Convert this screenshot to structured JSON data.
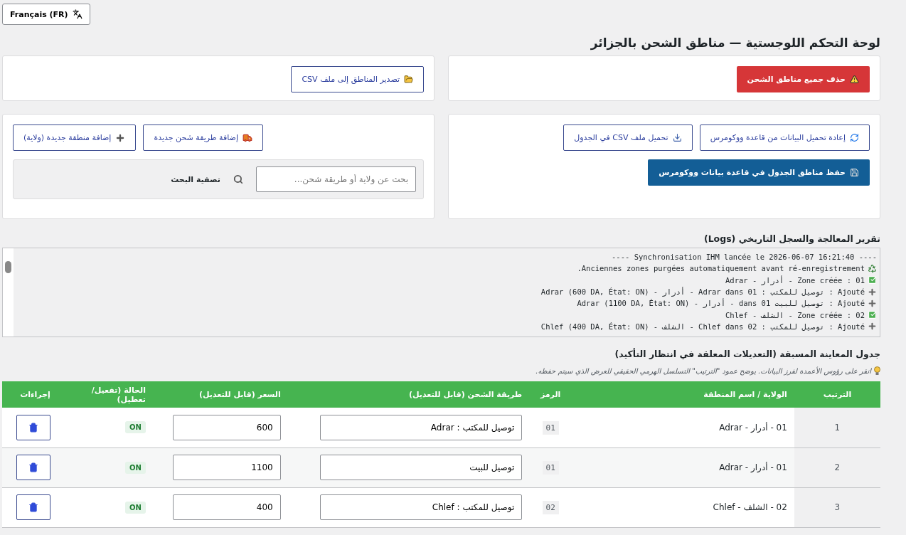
{
  "language_button": {
    "label": "Français (FR)"
  },
  "title": "لوحة التحكم اللوجستية — مناطق الشحن بالجزائر",
  "delete_all_button": {
    "label": "حذف جميع مناطق الشحن"
  },
  "export_button": {
    "label": "تصدير المناطق إلى ملف CSV"
  },
  "reload_button": {
    "label": "إعادة تحميل البيانات من قاعدة ووكومرس"
  },
  "upload_button": {
    "label": "تحميل ملف CSV في الجدول"
  },
  "save_button": {
    "label": "حفظ مناطق الجدول في قاعدة بيانات ووكومرس"
  },
  "add_method_button": {
    "label": "إضافة طريقة شحن جديدة"
  },
  "add_zone_button": {
    "label": "إضافة منطقة جديدة (ولاية)"
  },
  "search": {
    "placeholder": "بحث عن ولاية أو طريقة شحن...",
    "label": "تصفية البحث"
  },
  "logs": {
    "title": "تقرير المعالجة والسجل التاريخي (Logs)",
    "lines": [
      {
        "kind": "plain",
        "text": "---- Synchronisation IHM lancée le 2026-06-07 16:21:40 ----"
      },
      {
        "kind": "recycle",
        "text": "Anciennes zones purgées automatiquement avant ré-enregistrement."
      },
      {
        "kind": "check",
        "text": "01 : Zone créée - أدرار - Adrar"
      },
      {
        "kind": "plus",
        "text": "Ajouté : توصيل للمكتب : Adrar dans 01 - أدرار - Adrar (600 DA, État: ON)"
      },
      {
        "kind": "plus",
        "text": "Ajouté : توصيل للبيت dans 01 - أدرار - Adrar (1100 DA, État: ON)"
      },
      {
        "kind": "check",
        "text": "02 : Zone créée - الشلف - Chlef"
      },
      {
        "kind": "plus",
        "text": "Ajouté : توصيل للمكتب : Chlef dans 02 - الشلف - Chlef (400 DA, État: ON)"
      }
    ]
  },
  "preview": {
    "title": "جدول المعاينة المسبقة (التعديلات المعلقة في انتظار التأكيد)",
    "hint": "انقر على رؤوس الأعمدة لفرز البيانات. يوضح عمود \"الترتيب\" التسلسل الهرمي الحقيقي للعرض الذي سيتم حفظه.",
    "columns": [
      "الترتيب",
      "الولاية / اسم المنطقة",
      "الرمز",
      "طريقة الشحن (قابل للتعديل)",
      "السعر (قابل للتعديل)",
      "الحالة (تفعيل/تعطيل)",
      "إجراءات"
    ],
    "rows": [
      {
        "order": "1",
        "zone": "01 - أدرار - Adrar",
        "code": "01",
        "method": "توصيل للمكتب : Adrar",
        "price": "600",
        "status": "ON",
        "on": true
      },
      {
        "order": "2",
        "zone": "01 - أدرار - Adrar",
        "code": "01",
        "method": "توصيل للبيت",
        "price": "1100",
        "status": "ON",
        "on": true
      },
      {
        "order": "3",
        "zone": "02 - الشلف - Chlef",
        "code": "02",
        "method": "توصيل للمكتب : Chlef",
        "price": "400",
        "status": "ON",
        "on": true
      }
    ]
  }
}
